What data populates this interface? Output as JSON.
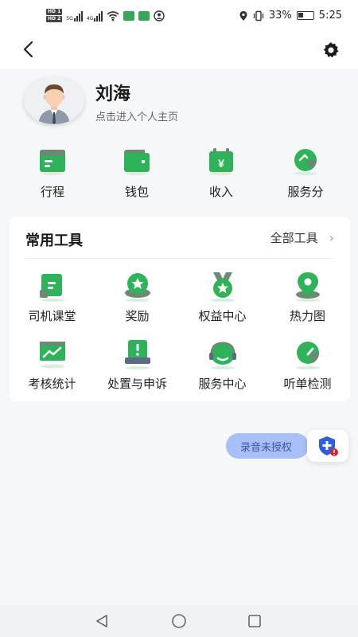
{
  "status_bar": {
    "network_1": "5G",
    "network_2": "4G",
    "battery": "33%",
    "time": "5:25"
  },
  "header": {
    "back_icon": "chevron-left-icon",
    "settings_icon": "gear-icon"
  },
  "profile": {
    "name": "刘海",
    "subtitle": "点击进入个人主页"
  },
  "quick_actions": [
    {
      "label": "行程",
      "icon": "itinerary-icon"
    },
    {
      "label": "钱包",
      "icon": "wallet-icon"
    },
    {
      "label": "收入",
      "icon": "income-icon"
    },
    {
      "label": "服务分",
      "icon": "service-score-icon"
    }
  ],
  "tools_card": {
    "title": "常用工具",
    "all_label": "全部工具",
    "items": [
      {
        "label": "司机课堂",
        "icon": "driver-class-icon"
      },
      {
        "label": "奖励",
        "icon": "reward-icon"
      },
      {
        "label": "权益中心",
        "icon": "benefits-icon"
      },
      {
        "label": "热力图",
        "icon": "heatmap-icon"
      },
      {
        "label": "考核统计",
        "icon": "assessment-icon"
      },
      {
        "label": "处置与申诉",
        "icon": "appeal-icon"
      },
      {
        "label": "服务中心",
        "icon": "service-center-icon"
      },
      {
        "label": "听单检测",
        "icon": "order-detect-icon"
      }
    ]
  },
  "floating": {
    "record_label": "录音未授权"
  },
  "colors": {
    "green": "#2fb35a",
    "green_light": "#7fdc93",
    "record_bg": "#a9bff7"
  }
}
